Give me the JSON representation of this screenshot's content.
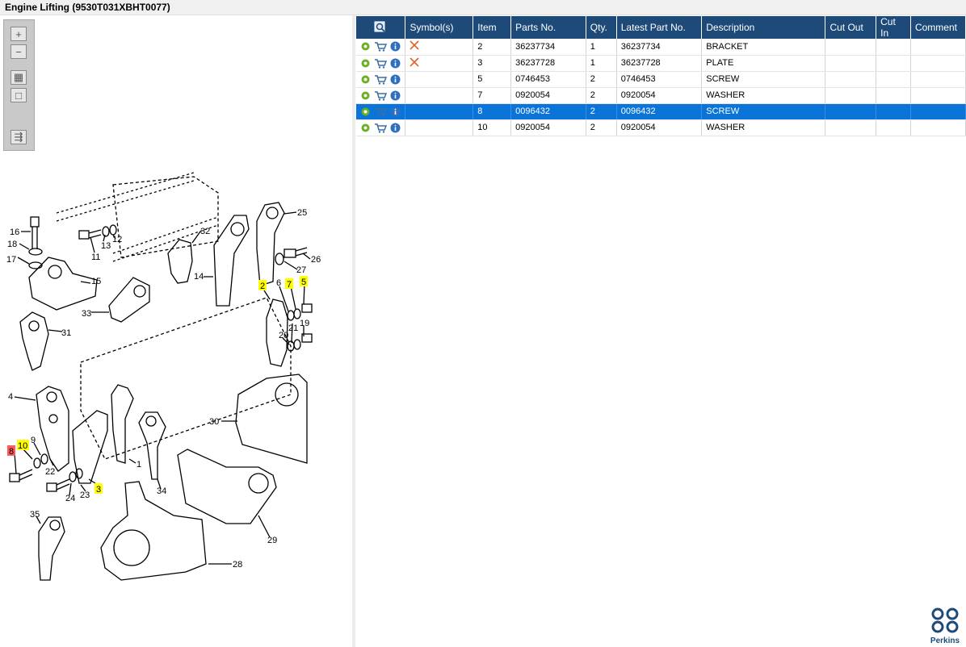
{
  "window": {
    "title": "Engine Lifting (9530T031XBHT0077)"
  },
  "toolbox": {
    "buttons": [
      {
        "name": "zoom-in-icon",
        "glyph": "+"
      },
      {
        "name": "zoom-out-icon",
        "glyph": "−"
      },
      {
        "name": "fit-all-icon",
        "glyph": "▦"
      },
      {
        "name": "fit-window-icon",
        "glyph": "□"
      },
      {
        "name": "export-icon",
        "glyph": "⇶"
      }
    ]
  },
  "drawing": {
    "callouts": [
      "16",
      "18",
      "17",
      "11",
      "13",
      "12",
      "15",
      "31",
      "33",
      "32",
      "14",
      "25",
      "26",
      "27",
      "2",
      "6",
      "7",
      "5",
      "21",
      "19",
      "20",
      "4",
      "10",
      "9",
      "8",
      "22",
      "3",
      "23",
      "24",
      "1",
      "34",
      "30",
      "35",
      "29",
      "28"
    ],
    "highlighted": [
      "2",
      "7",
      "5",
      "10",
      "3"
    ],
    "selected": [
      "8"
    ]
  },
  "table": {
    "columns": [
      "",
      "Symbol(s)",
      "Item",
      "Parts No.",
      "Qty.",
      "Latest Part No.",
      "Description",
      "Cut Out",
      "Cut In",
      "Comment"
    ],
    "rows": [
      {
        "symbol": "x",
        "item": "2",
        "part_no": "36237734",
        "qty": "1",
        "latest": "36237734",
        "desc": "BRACKET",
        "cut_out": "",
        "cut_in": "",
        "comment": ""
      },
      {
        "symbol": "x",
        "item": "3",
        "part_no": "36237728",
        "qty": "1",
        "latest": "36237728",
        "desc": "PLATE",
        "cut_out": "",
        "cut_in": "",
        "comment": ""
      },
      {
        "symbol": "",
        "item": "5",
        "part_no": "0746453",
        "qty": "2",
        "latest": "0746453",
        "desc": "SCREW",
        "cut_out": "",
        "cut_in": "",
        "comment": ""
      },
      {
        "symbol": "",
        "item": "7",
        "part_no": "0920054",
        "qty": "2",
        "latest": "0920054",
        "desc": "WASHER",
        "cut_out": "",
        "cut_in": "",
        "comment": ""
      },
      {
        "symbol": "",
        "item": "8",
        "part_no": "0096432",
        "qty": "2",
        "latest": "0096432",
        "desc": "SCREW",
        "cut_out": "",
        "cut_in": "",
        "comment": "",
        "selected": true
      },
      {
        "symbol": "",
        "item": "10",
        "part_no": "0920054",
        "qty": "2",
        "latest": "0920054",
        "desc": "WASHER",
        "cut_out": "",
        "cut_in": "",
        "comment": ""
      }
    ]
  },
  "brand": {
    "name": "Perkins"
  },
  "colors": {
    "header": "#1e4a7a",
    "selected": "#0a74d8",
    "highlight": "#ffff00",
    "selected_callout": "#ff5a5a",
    "remove": "#e0622a"
  }
}
